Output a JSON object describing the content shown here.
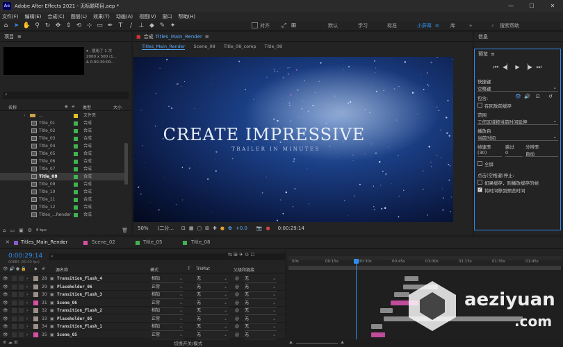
{
  "app": {
    "title": "Adobe After Effects 2021 - 无标题项目.aep *",
    "logo": "Ae",
    "window_controls": [
      "—",
      "☐",
      "✕"
    ]
  },
  "menu": [
    "文件(F)",
    "编辑(E)",
    "合成(C)",
    "图层(L)",
    "效果(T)",
    "动画(A)",
    "视图(V)",
    "窗口",
    "帮助(H)"
  ],
  "toolbar": {
    "align_label": "对齐",
    "workspaces": [
      "默认",
      "学习",
      "标准",
      "小屏幕"
    ],
    "active_workspace": "小屏幕",
    "workspace_more": "库",
    "search_placeholder": "搜索帮助"
  },
  "project": {
    "title": "项目",
    "menu_icon": "≡",
    "thumb_info": [
      "▾ , 使用了 1 次",
      "2000 x 500 (1...",
      "Δ 0:00:30:00..."
    ],
    "search_icon": "⌕",
    "columns": {
      "name": "名称",
      "type": "类型",
      "size": "大小"
    },
    "folder": {
      "name": "...",
      "type": "文件夹"
    },
    "items": [
      {
        "name": "Title_01",
        "type": "合成"
      },
      {
        "name": "Title_02",
        "type": "合成"
      },
      {
        "name": "Title_03",
        "type": "合成"
      },
      {
        "name": "Title_04",
        "type": "合成"
      },
      {
        "name": "Title_05",
        "type": "合成"
      },
      {
        "name": "Title_06",
        "type": "合成"
      },
      {
        "name": "Title_07",
        "type": "合成"
      },
      {
        "name": "Title_08",
        "type": "合成"
      },
      {
        "name": "Title_09",
        "type": "合成"
      },
      {
        "name": "Title_10",
        "type": "合成"
      },
      {
        "name": "Title_11",
        "type": "合成"
      },
      {
        "name": "Title_12",
        "type": "合成"
      },
      {
        "name": "Titles_...Render",
        "type": "合成"
      }
    ],
    "selected_index": 7,
    "bpc": "8 bpc"
  },
  "composition": {
    "panel_label": "合成",
    "comp_name": "Titles_Main_Render",
    "menu_icon": "≡",
    "tabs": [
      "Titles_Main_Render",
      "Scene_08",
      "Title_08_comp",
      "Title_08"
    ],
    "active_tab": 0,
    "headline": "CREATE IMPRESSIVE",
    "subline": "TRAILER IN MINUTES",
    "zoom": "50%",
    "resolution": "(二分...",
    "exposure": "+0.0",
    "timecode": "0:00:29:14"
  },
  "info_panel": {
    "title": "信息"
  },
  "preview": {
    "title": "预览",
    "menu_icon": "≡",
    "shortcut_label": "快捷键",
    "shortcut_value": "空格键",
    "include_label": "包含:",
    "cache_label": "在回放前缓存",
    "range_label": "范围",
    "range_value": "工作区域按当前时间延伸",
    "play_from_label": "播放自",
    "play_from_value": "当前时间",
    "fps_label": "帧速率",
    "skip_label": "跳过",
    "res_label": "分辨率",
    "fps_value": "(30)",
    "skip_value": "0",
    "res_value": "自动",
    "fullscreen_label": "全屏",
    "stop_label": "点击(空格键)停止:",
    "opt1": "如果缓存，则播放缓存的帧",
    "opt2": "将时间移到预览时间",
    "opt1_checked": false,
    "opt2_checked": true
  },
  "timeline": {
    "tabs": [
      {
        "name": "Titles_Main_Render",
        "color": "#8a5ac9"
      },
      {
        "name": "Scene_02",
        "color": "#d84ea2"
      },
      {
        "name": "Title_05",
        "color": "#3fb34f"
      },
      {
        "name": "Title_08",
        "color": "#3fb34f"
      }
    ],
    "timecode": "0:00:29:14",
    "frames": "00884 (30.00 fps)",
    "col_name": "源名称",
    "col_mode": "模式",
    "col_t": "T",
    "col_trkmat": "TrkMat",
    "col_parent": "父级和链接",
    "ruler": [
      "00s",
      "00:15s",
      "00:30s",
      "00:45s",
      "01:00s",
      "01:15s",
      "01:30s",
      "01:45s"
    ],
    "layers": [
      {
        "num": "28",
        "name": "Transition_Flash_4",
        "mode": "相加",
        "trk": "无",
        "parent": "无",
        "color": "#9b8f88"
      },
      {
        "num": "29",
        "name": "Placeholder_06",
        "mode": "正常",
        "trk": "无",
        "parent": "无",
        "color": "#9b8f88"
      },
      {
        "num": "30",
        "name": "Transition_Flash_3",
        "mode": "相加",
        "trk": "无",
        "parent": "无",
        "color": "#9b8f88"
      },
      {
        "num": "31",
        "name": "Scene_06",
        "mode": "正常",
        "trk": "无",
        "parent": "无",
        "color": "#d84ea2"
      },
      {
        "num": "32",
        "name": "Transition_Flash_2",
        "mode": "相加",
        "trk": "无",
        "parent": "无",
        "color": "#9b8f88"
      },
      {
        "num": "33",
        "name": "Placeholder_05",
        "mode": "正常",
        "trk": "无",
        "parent": "无",
        "color": "#9b8f88"
      },
      {
        "num": "34",
        "name": "Transition_Flash_1",
        "mode": "相加",
        "trk": "无",
        "parent": "无",
        "color": "#9b8f88"
      },
      {
        "num": "35",
        "name": "Scene_05",
        "mode": "正常",
        "trk": "无",
        "parent": "无",
        "color": "#d84ea2"
      }
    ],
    "footer_label": "切换开关/模式"
  },
  "watermark": {
    "line1": "aeziyuan",
    "line2": ".com"
  },
  "colors": {
    "accent": "#2d8ceb",
    "comp_green": "#3fb34f",
    "scene_pink": "#d84ea2",
    "playhead": "#2d8ceb"
  }
}
